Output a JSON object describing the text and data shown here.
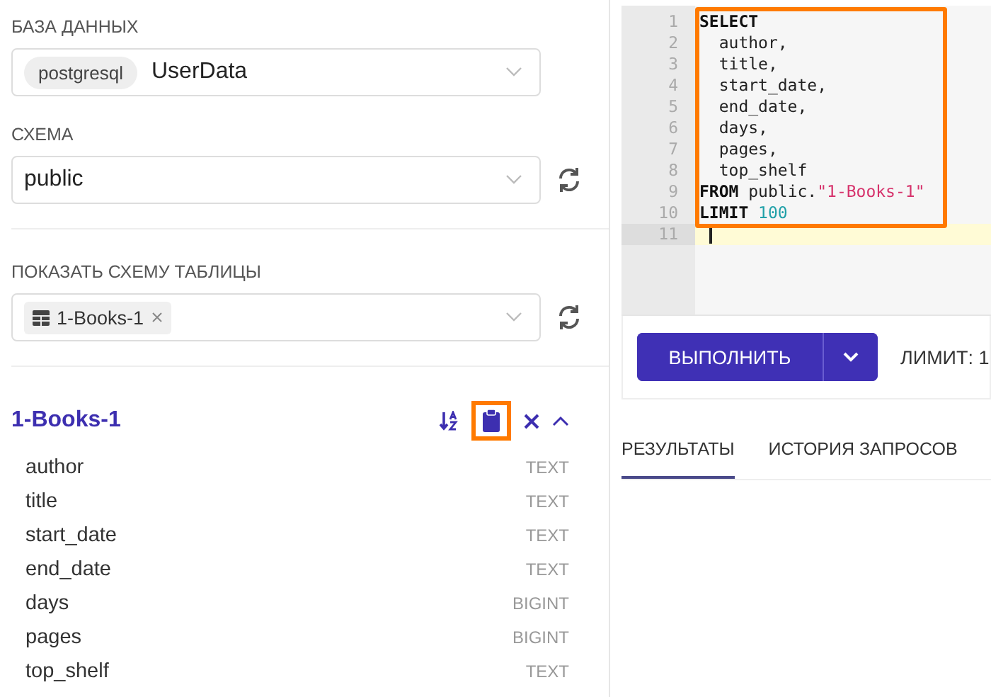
{
  "database": {
    "label": "БАЗА ДАННЫХ",
    "engine": "postgresql",
    "value": "UserData"
  },
  "schema": {
    "label": "СХЕМА",
    "value": "public"
  },
  "table_schema": {
    "label": "ПОКАЗАТЬ СХЕМУ ТАБЛИЦЫ",
    "tags": [
      "1-Books-1"
    ]
  },
  "table": {
    "name": "1-Books-1",
    "expanded": true,
    "copy_highlighted": true,
    "columns": [
      {
        "name": "author",
        "type": "TEXT"
      },
      {
        "name": "title",
        "type": "TEXT"
      },
      {
        "name": "start_date",
        "type": "TEXT"
      },
      {
        "name": "end_date",
        "type": "TEXT"
      },
      {
        "name": "days",
        "type": "BIGINT"
      },
      {
        "name": "pages",
        "type": "BIGINT"
      },
      {
        "name": "top_shelf",
        "type": "TEXT"
      }
    ]
  },
  "editor": {
    "highlighted": true,
    "lines": [
      {
        "number": "1",
        "current": false,
        "tokens": [
          {
            "kind": "keyword",
            "text": "SELECT"
          }
        ]
      },
      {
        "number": "2",
        "current": false,
        "tokens": [
          {
            "kind": "plain",
            "text": "  author,"
          }
        ]
      },
      {
        "number": "3",
        "current": false,
        "tokens": [
          {
            "kind": "plain",
            "text": "  title,"
          }
        ]
      },
      {
        "number": "4",
        "current": false,
        "tokens": [
          {
            "kind": "plain",
            "text": "  start_date,"
          }
        ]
      },
      {
        "number": "5",
        "current": false,
        "tokens": [
          {
            "kind": "plain",
            "text": "  end_date,"
          }
        ]
      },
      {
        "number": "6",
        "current": false,
        "tokens": [
          {
            "kind": "plain",
            "text": "  days,"
          }
        ]
      },
      {
        "number": "7",
        "current": false,
        "tokens": [
          {
            "kind": "plain",
            "text": "  pages,"
          }
        ]
      },
      {
        "number": "8",
        "current": false,
        "tokens": [
          {
            "kind": "plain",
            "text": "  top_shelf"
          }
        ]
      },
      {
        "number": "9",
        "current": false,
        "tokens": [
          {
            "kind": "keyword",
            "text": "FROM"
          },
          {
            "kind": "plain",
            "text": "public."
          },
          {
            "kind": "string",
            "text": "\"1-Books-1\""
          }
        ]
      },
      {
        "number": "10",
        "current": false,
        "tokens": [
          {
            "kind": "keyword",
            "text": "LIMIT"
          },
          {
            "kind": "number",
            "text": "100"
          }
        ]
      },
      {
        "number": "11",
        "current": true
      }
    ]
  },
  "run_button": "ВЫПОЛНИТЬ",
  "limit_label": "ЛИМИТ:  1",
  "tabs": [
    {
      "label": "РЕЗУЛЬТАТЫ",
      "selected": true
    },
    {
      "label": "ИСТОРИЯ ЗАПРОСОВ",
      "selected": false
    }
  ]
}
